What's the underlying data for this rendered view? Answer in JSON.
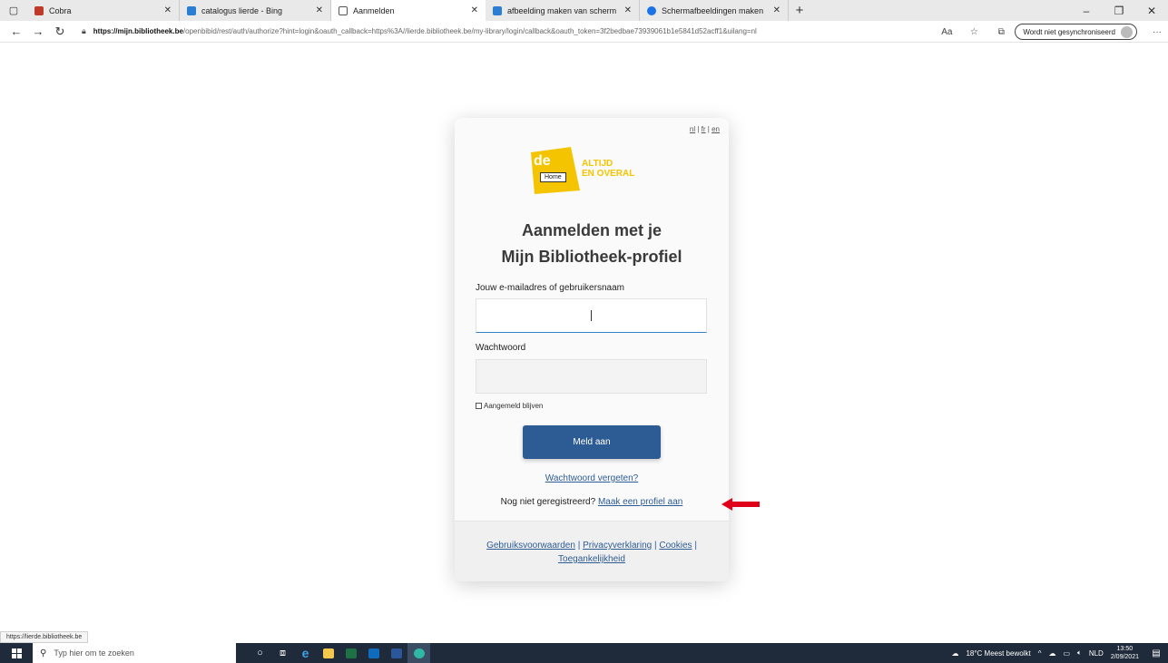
{
  "browser": {
    "tabs": [
      {
        "title": "Cobra",
        "favicon_color": "#c0392b",
        "active": false
      },
      {
        "title": "catalogus lierde - Bing",
        "favicon_color": "#2a7fd4",
        "active": false
      },
      {
        "title": "Aanmelden",
        "favicon_color": "#ffffff",
        "active": true
      },
      {
        "title": "afbeelding maken van scherm - ",
        "favicon_color": "#2a7fd4",
        "active": false
      },
      {
        "title": "Schermafbeeldingen maken op ",
        "favicon_color": "#1a73e8",
        "active": false
      }
    ],
    "new_tab_label": "+",
    "window_controls": {
      "minimize": "–",
      "restore": "❐",
      "close": "✕"
    },
    "address": {
      "host": "https://mijn.bibliotheek.be",
      "path": "/openbibid/rest/auth/authorize?hint=login&oauth_callback=https%3A//lierde.bibliotheek.be/my-library/login/callback&oauth_token=3f2bedbae73939061b1e5841d52acff1&uilang=nl"
    },
    "sync_label": "Wordt niet gesynchroniseerd",
    "status_url": "https://lierde.bibliotheek.be"
  },
  "login": {
    "languages": [
      "nl",
      "fr",
      "en"
    ],
    "logo_word": "de",
    "logo_tagline_1": "ALTIJD",
    "logo_tagline_2": "EN OVERAL",
    "tooltip": "Home",
    "heading_line1": "Aanmelden met je",
    "heading_line2": "Mijn Bibliotheek-profiel",
    "username_label": "Jouw e-mailadres of gebruikersnaam",
    "username_value": "",
    "password_label": "Wachtwoord",
    "remember_label": "Aangemeld blijven",
    "submit_label": "Meld aan",
    "forgot_label": "Wachtwoord vergeten?",
    "register_prompt": "Nog niet geregistreerd?",
    "register_link": "Maak een profiel aan",
    "footer_links": [
      "Gebruiksvoorwaarden",
      "Privacyverklaring",
      "Cookies",
      "Toegankelijkheid"
    ],
    "accent_color": "#2d5b94",
    "logo_color": "#f5c400"
  },
  "taskbar": {
    "search_placeholder": "Typ hier om te zoeken",
    "weather": "18°C  Meest bewolkt",
    "language": "NLD",
    "time": "13:50",
    "date": "2/09/2021"
  }
}
